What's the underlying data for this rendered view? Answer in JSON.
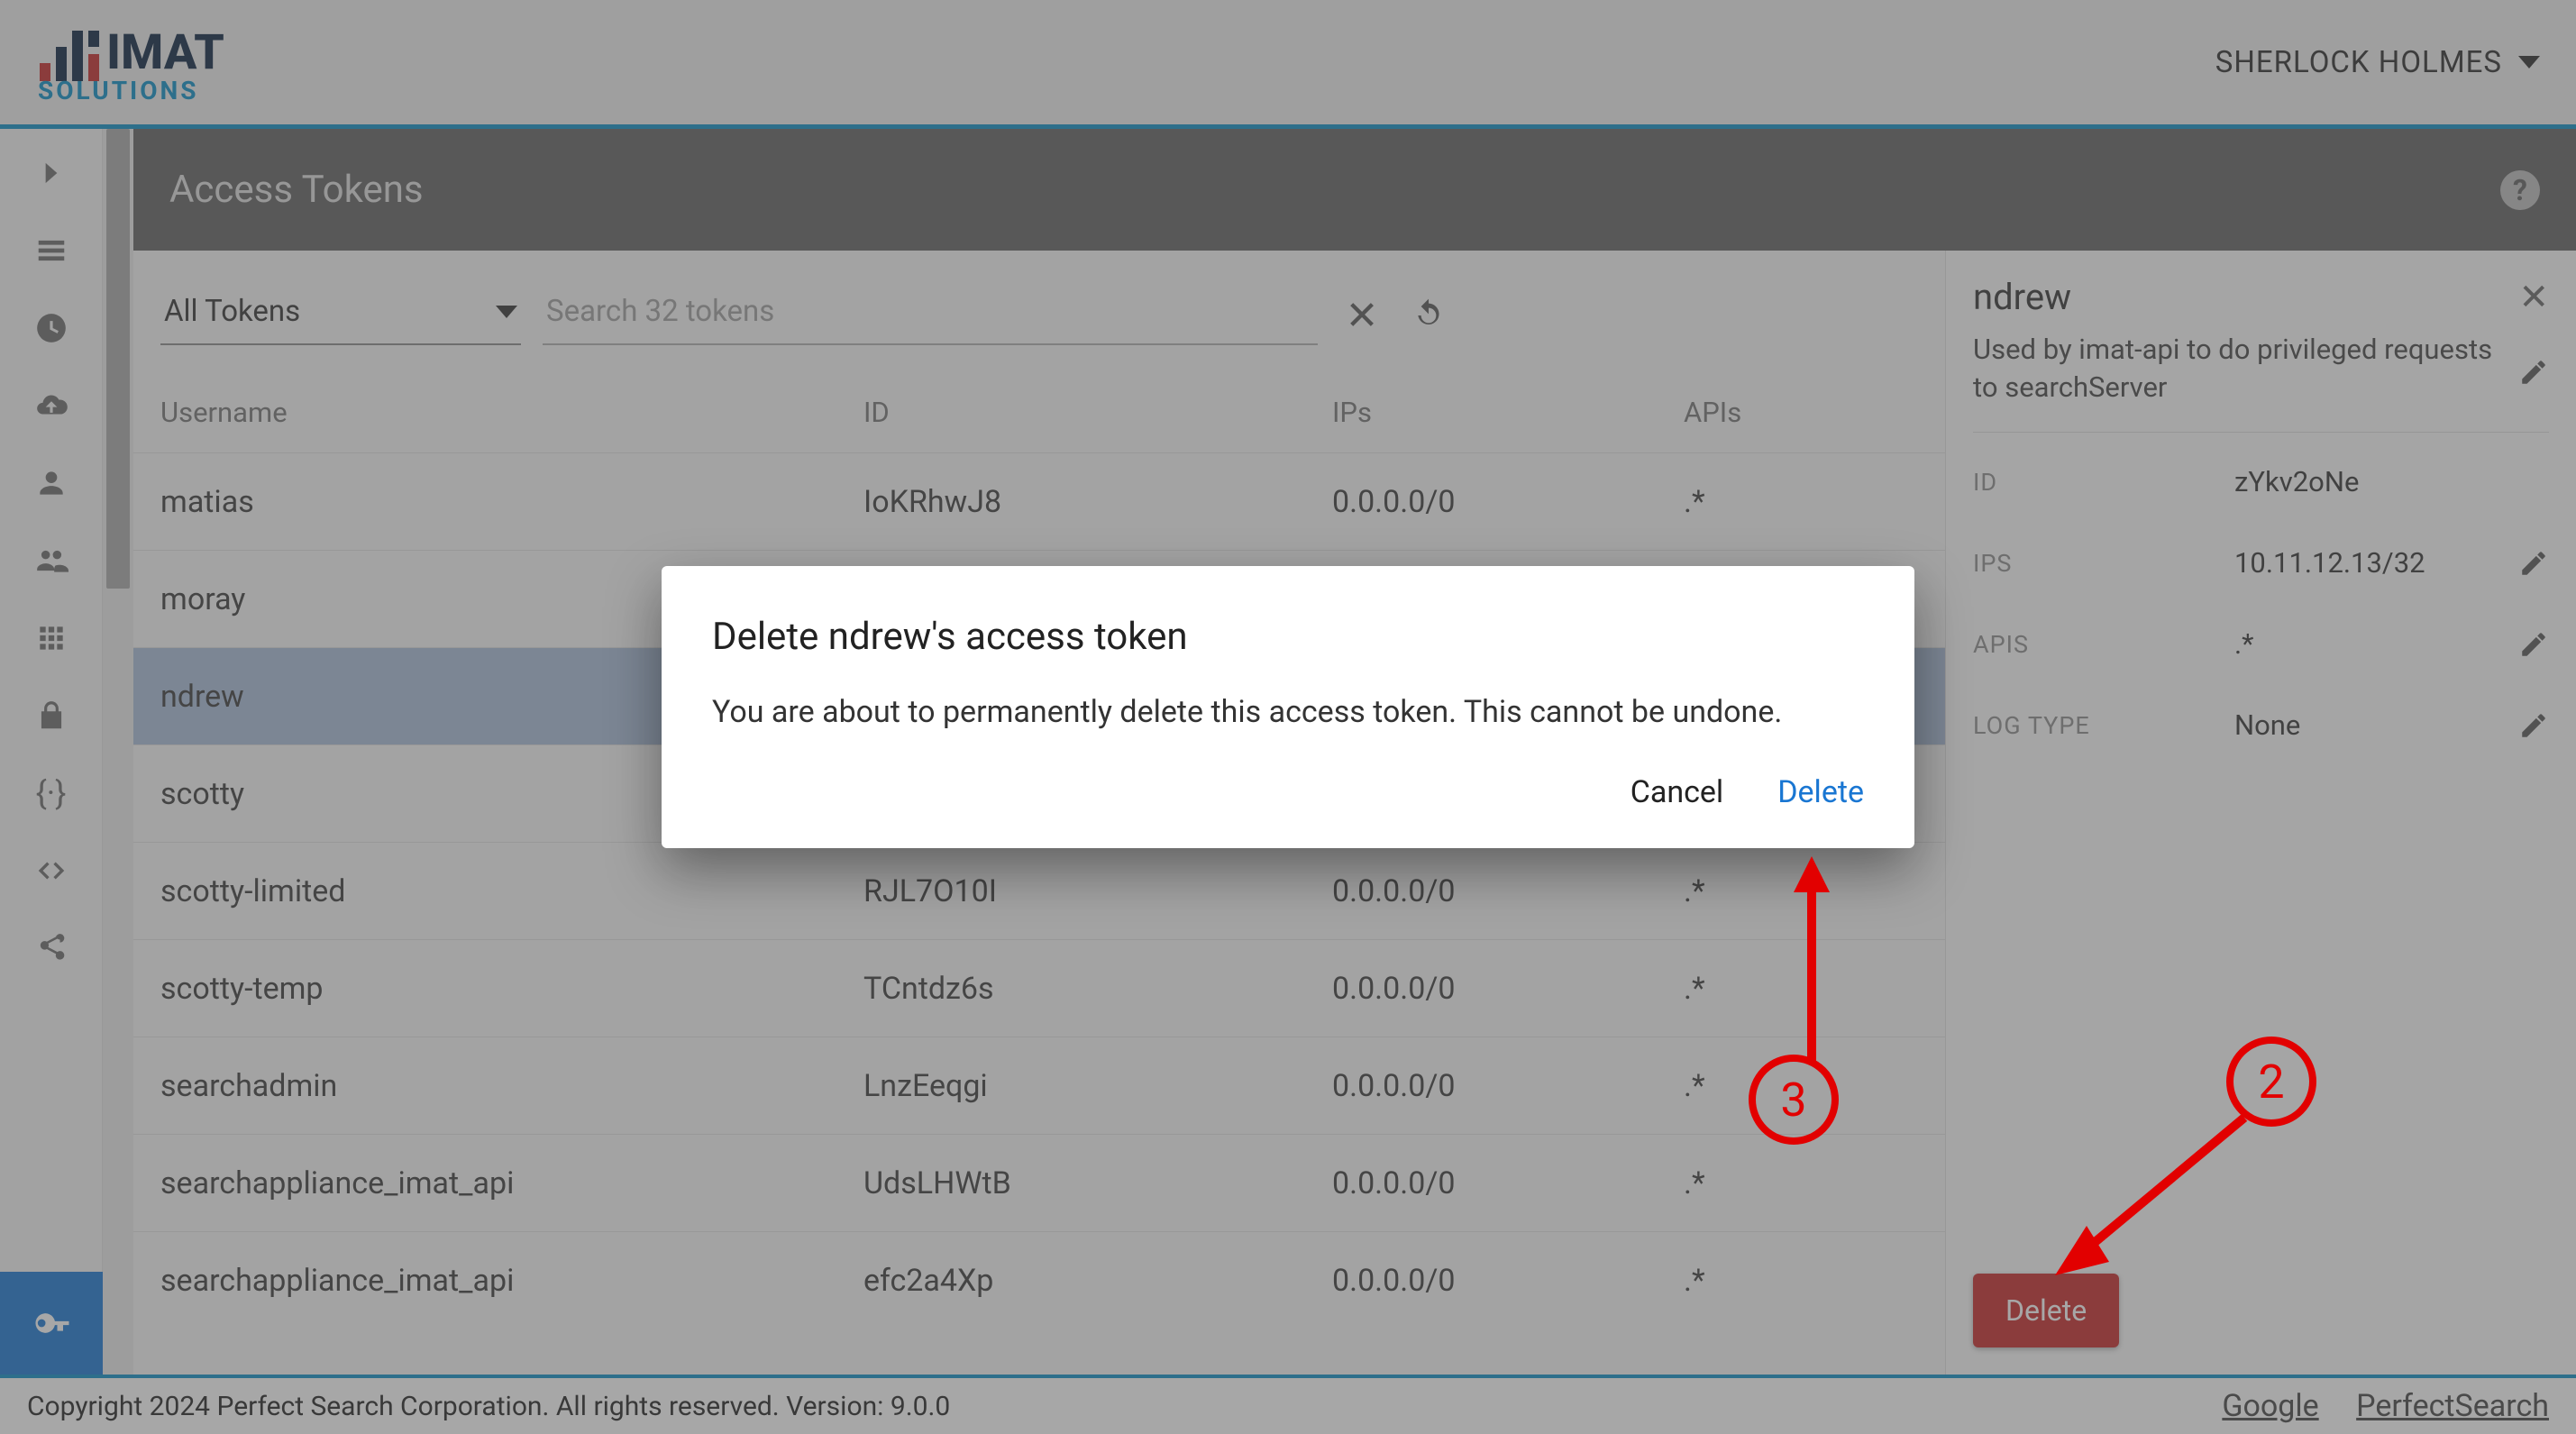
{
  "header": {
    "user_name": "SHERLOCK HOLMES"
  },
  "page": {
    "title": "Access Tokens"
  },
  "filter": {
    "dropdown_label": "All Tokens",
    "search_placeholder": "Search 32 tokens"
  },
  "columns": {
    "username": "Username",
    "id": "ID",
    "ips": "IPs",
    "apis": "APIs"
  },
  "rows": [
    {
      "username": "matias",
      "id": "IoKRhwJ8",
      "ips": "0.0.0.0/0",
      "apis": ".*"
    },
    {
      "username": "moray",
      "id": "",
      "ips": "",
      "apis": ""
    },
    {
      "username": "ndrew",
      "id": "",
      "ips": "",
      "apis": ""
    },
    {
      "username": "scotty",
      "id": "",
      "ips": "",
      "apis": ""
    },
    {
      "username": "scotty-limited",
      "id": "RJL7O10I",
      "ips": "0.0.0.0/0",
      "apis": ".*"
    },
    {
      "username": "scotty-temp",
      "id": "TCntdz6s",
      "ips": "0.0.0.0/0",
      "apis": ".*"
    },
    {
      "username": "searchadmin",
      "id": "LnzEeqgi",
      "ips": "0.0.0.0/0",
      "apis": ".*"
    },
    {
      "username": "searchappliance_imat_api",
      "id": "UdsLHWtB",
      "ips": "0.0.0.0/0",
      "apis": ".*"
    },
    {
      "username": "searchappliance_imat_api",
      "id": "efc2a4Xp",
      "ips": "0.0.0.0/0",
      "apis": ".*"
    }
  ],
  "selected_row_index": 2,
  "detail": {
    "title": "ndrew",
    "description": "Used by imat-api to do privileged requests to searchServer",
    "fields": {
      "id_label": "ID",
      "id_value": "zYkv2oNe",
      "ips_label": "IPS",
      "ips_value": "10.11.12.13/32",
      "apis_label": "APIS",
      "apis_value": ".*",
      "log_label": "LOG TYPE",
      "log_value": "None"
    },
    "delete_label": "Delete"
  },
  "modal": {
    "title": "Delete ndrew's access token",
    "body": "You are about to permanently delete this access token. This cannot be undone.",
    "cancel": "Cancel",
    "delete": "Delete"
  },
  "footer": {
    "copyright": "Copyright 2024 Perfect Search Corporation. All rights reserved. Version: 9.0.0",
    "link1": "Google",
    "link2": "PerfectSearch"
  },
  "annotations": {
    "n2": "2",
    "n3": "3"
  }
}
